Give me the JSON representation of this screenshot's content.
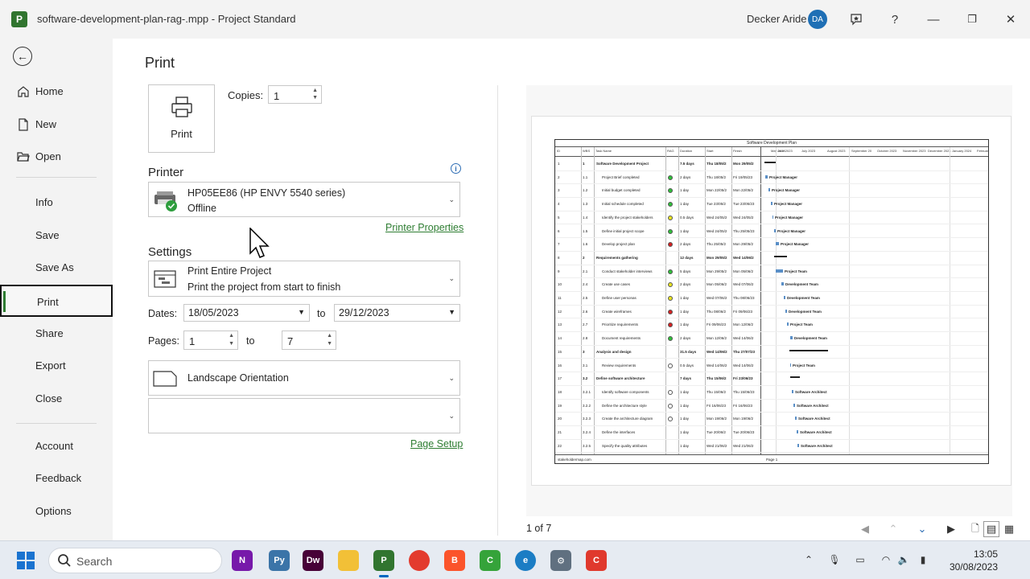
{
  "titlebar": {
    "app_icon_letter": "P",
    "title": "software-development-plan-rag-.mpp  -  Project Standard",
    "user_name": "Decker Aride",
    "user_initials": "DA",
    "help": "?",
    "minimize": "—",
    "restore": "❐",
    "close": "✕"
  },
  "nav": {
    "back": "←",
    "items": [
      {
        "label": "Home",
        "icon": "home-icon"
      },
      {
        "label": "New",
        "icon": "new-document-icon"
      },
      {
        "label": "Open",
        "icon": "folder-open-icon"
      },
      {
        "label": "Info"
      },
      {
        "label": "Save"
      },
      {
        "label": "Save As"
      },
      {
        "label": "Print",
        "active": true
      },
      {
        "label": "Share"
      },
      {
        "label": "Export"
      },
      {
        "label": "Close"
      },
      {
        "label": "Account"
      },
      {
        "label": "Feedback"
      },
      {
        "label": "Options"
      }
    ]
  },
  "print": {
    "title": "Print",
    "print_button": "Print",
    "copies_label": "Copies:",
    "copies_value": "1",
    "printer_heading": "Printer",
    "printer_name": "HP05EE86 (HP ENVY 5540 series)",
    "printer_status": "Offline",
    "printer_properties": "Printer Properties",
    "settings_heading": "Settings",
    "range_title": "Print Entire Project",
    "range_desc": "Print the project from start to finish",
    "dates_label": "Dates:",
    "date_from": "18/05/2023",
    "to_label": "to",
    "date_to": "29/12/2023",
    "pages_label": "Pages:",
    "page_from": "1",
    "page_to": "7",
    "orientation": "Landscape Orientation",
    "page_setup": "Page Setup"
  },
  "preview": {
    "page_counter": "1 of 7",
    "sheet_title": "Software Development Plan",
    "columns": [
      "ID",
      "WBS",
      "Task Name",
      "RAG",
      "Duration",
      "Start",
      "Finish"
    ],
    "timeline_months": [
      "May 2023",
      "June 2023",
      "July 2023",
      "August 2023",
      "September 20",
      "October 2023",
      "November 2023",
      "December 2023",
      "January 2024",
      "Februar"
    ],
    "rows": [
      {
        "id": "1",
        "wbs": "1",
        "name": "Software Development Project",
        "dur": "7.5 days",
        "start": "Thu 18/05/2",
        "finish": "Mon 29/05/2",
        "bold": true,
        "rag": ""
      },
      {
        "id": "2",
        "wbs": "1.1",
        "name": "Project Brief completed",
        "dur": "2 days",
        "start": "Thu 18/05/2",
        "finish": "Fri 19/05/23",
        "rag": "#2fbf3a",
        "res": "Project Manager"
      },
      {
        "id": "3",
        "wbs": "1.2",
        "name": "Initial budget completed",
        "dur": "1 day",
        "start": "Mon 22/05/2",
        "finish": "Mon 22/05/2",
        "rag": "#2fbf3a",
        "res": "Project Manager"
      },
      {
        "id": "4",
        "wbs": "1.3",
        "name": "Initial schedule completed",
        "dur": "1 day",
        "start": "Tue 23/05/2",
        "finish": "Tue 23/05/23",
        "rag": "#2fbf3a",
        "res": "Project Manager"
      },
      {
        "id": "5",
        "wbs": "1.4",
        "name": "Identify the project stakeholders",
        "dur": "0.5 days",
        "start": "Wed 24/05/2",
        "finish": "Wed 24/05/2",
        "rag": "#e8e220",
        "res": "Project Manager"
      },
      {
        "id": "6",
        "wbs": "1.5",
        "name": "Define initial project scope",
        "dur": "1 day",
        "start": "Wed 24/05/2",
        "finish": "Thu 25/05/23",
        "rag": "#2fbf3a",
        "res": "Project Manager"
      },
      {
        "id": "7",
        "wbs": "1.6",
        "name": "Develop project plan",
        "dur": "2 days",
        "start": "Thu 25/05/2",
        "finish": "Mon 29/05/2",
        "rag": "#d42020",
        "res": "Project Manager"
      },
      {
        "id": "8",
        "wbs": "2",
        "name": "Requirements gathering",
        "dur": "12 days",
        "start": "Mon 29/05/2",
        "finish": "Wed 14/06/2",
        "bold": true,
        "rag": ""
      },
      {
        "id": "9",
        "wbs": "2.1",
        "name": "Conduct stakeholder interviews",
        "dur": "5 days",
        "start": "Mon 29/05/2",
        "finish": "Mon 05/06/2",
        "rag": "#2fbf3a",
        "res": "Project Team"
      },
      {
        "id": "10",
        "wbs": "2.4",
        "name": "Create use cases",
        "dur": "2 days",
        "start": "Mon 05/06/2",
        "finish": "Wed 07/06/2",
        "rag": "#e8e220",
        "res": "Development Team"
      },
      {
        "id": "11",
        "wbs": "2.5",
        "name": "Define user personas",
        "dur": "1 day",
        "start": "Wed 07/06/2",
        "finish": "Thu 08/06/23",
        "rag": "#e8e220",
        "res": "Development Team"
      },
      {
        "id": "12",
        "wbs": "2.6",
        "name": "Create wireframes",
        "dur": "1 day",
        "start": "Thu 08/06/2",
        "finish": "Fri 09/06/23",
        "rag": "#d42020",
        "res": "Development Team"
      },
      {
        "id": "13",
        "wbs": "2.7",
        "name": "Prioritize requirements",
        "dur": "1 day",
        "start": "Fri 09/06/23",
        "finish": "Mon 12/06/2",
        "rag": "#d42020",
        "res": "Project Team"
      },
      {
        "id": "14",
        "wbs": "2.8",
        "name": "Document requirements",
        "dur": "2 days",
        "start": "Mon 12/06/2",
        "finish": "Wed 14/06/2",
        "rag": "#2fbf3a",
        "res": "Development Team"
      },
      {
        "id": "15",
        "wbs": "3",
        "name": "Analysis and design",
        "dur": "31.5 days",
        "start": "Wed 14/06/2",
        "finish": "Thu 27/07/23",
        "bold": true,
        "rag": ""
      },
      {
        "id": "16",
        "wbs": "3.1",
        "name": "Review requirements",
        "dur": "0.5 days",
        "start": "Wed 14/06/2",
        "finish": "Wed 14/06/2",
        "rag": "#ffffff",
        "res": "Project Team"
      },
      {
        "id": "17",
        "wbs": "3.2",
        "name": "Define software architecture",
        "dur": "7 days",
        "start": "Thu 15/06/2",
        "finish": "Fri 23/06/23",
        "bold": true,
        "rag": ""
      },
      {
        "id": "18",
        "wbs": "3.2.1",
        "name": "Identify software components",
        "dur": "1 day",
        "start": "Thu 15/06/2",
        "finish": "Thu 15/06/23",
        "rag": "#ffffff",
        "res": "Software Architect"
      },
      {
        "id": "19",
        "wbs": "3.2.2",
        "name": "Define the architecture style",
        "dur": "1 day",
        "start": "Fri 16/06/23",
        "finish": "Fri 16/06/23",
        "rag": "#ffffff",
        "res": "Software Architect"
      },
      {
        "id": "20",
        "wbs": "3.2.3",
        "name": "Create the architecture diagram",
        "dur": "1 day",
        "start": "Mon 19/06/2",
        "finish": "Mon 19/06/2",
        "rag": "#ffffff",
        "res": "Software Architect"
      },
      {
        "id": "21",
        "wbs": "3.2.4",
        "name": "Define the interfaces",
        "dur": "1 day",
        "start": "Tue 20/06/2",
        "finish": "Tue 20/06/23",
        "rag": "",
        "res": "Software Architect"
      },
      {
        "id": "22",
        "wbs": "3.2.5",
        "name": "Specify the quality attributes",
        "dur": "1 day",
        "start": "Wed 21/06/2",
        "finish": "Wed 21/06/2",
        "rag": "",
        "res": "Software Architect"
      }
    ],
    "footer_left": "stakeholdermap.com",
    "footer_right": "Page 1"
  },
  "taskbar": {
    "search_placeholder": "Search",
    "apps": [
      {
        "name": "onenote",
        "letter": "N",
        "color": "#7719aa"
      },
      {
        "name": "python",
        "letter": "Py",
        "color": "#3b74a8"
      },
      {
        "name": "dreamweaver",
        "letter": "Dw",
        "color": "#470137"
      },
      {
        "name": "file-explorer",
        "letter": "",
        "color": "#f2c037"
      },
      {
        "name": "project",
        "letter": "P",
        "color": "#31752f",
        "active": true
      },
      {
        "name": "chrome",
        "letter": "",
        "color": "#e33b2e"
      },
      {
        "name": "brave",
        "letter": "B",
        "color": "#fb542b"
      },
      {
        "name": "camtasia",
        "letter": "C",
        "color": "#35a33a"
      },
      {
        "name": "edge",
        "letter": "e",
        "color": "#1b7dc4"
      },
      {
        "name": "settings",
        "letter": "⚙",
        "color": "#607080"
      },
      {
        "name": "recorder",
        "letter": "C",
        "color": "#e0392d"
      }
    ],
    "time": "13:05",
    "date": "30/08/2023"
  }
}
